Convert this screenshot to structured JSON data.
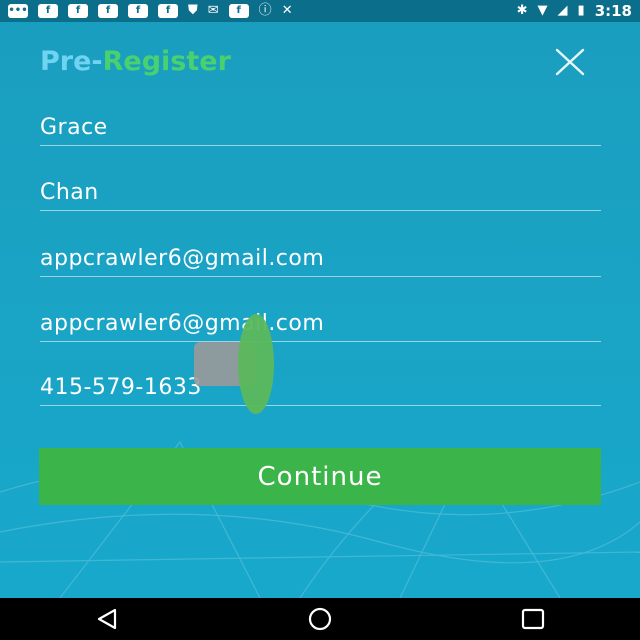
{
  "status_bar": {
    "notification_icons": [
      "facebook-icon",
      "facebook-icon",
      "facebook-icon",
      "facebook-icon",
      "facebook-icon",
      "shield-icon",
      "message-icon",
      "facebook-icon",
      "alert-icon",
      "silent-icon"
    ],
    "time": "3:18"
  },
  "header": {
    "title_part1": "Pre-",
    "title_part2": "Register",
    "close_icon": "close-icon"
  },
  "form": {
    "first_name": "Grace",
    "last_name": "Chan",
    "email": "appcrawler6@gmail.com",
    "confirm_email": "appcrawler6@gmail.com",
    "phone": "415-579-1633"
  },
  "actions": {
    "continue_label": "Continue"
  },
  "nav_bar": {
    "back": "back-icon",
    "home": "home-icon",
    "recents": "recents-icon"
  },
  "colors": {
    "background": "#1aa3c4",
    "title_pre": "#6fd3f1",
    "title_register": "#49d06f",
    "button": "#3bb54a"
  }
}
